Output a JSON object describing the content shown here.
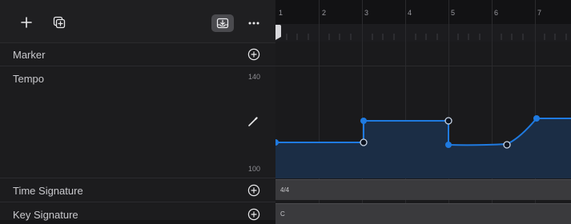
{
  "toolbar": {
    "add_icon": "plus-icon",
    "duplicate_icon": "duplicate-icon",
    "import_icon": "import-tray-icon",
    "more_icon": "ellipsis-icon"
  },
  "rows": {
    "marker": "Marker",
    "tempo": "Tempo",
    "tempo_max": "140",
    "tempo_min": "100",
    "time_signature": "Time Signature",
    "key_signature": "Key Signature"
  },
  "ruler": {
    "bars": [
      "1",
      "2",
      "3",
      "4",
      "5",
      "6",
      "7"
    ]
  },
  "tracks": {
    "time_signature_value": "4/4",
    "key_signature_value": "C"
  },
  "colors": {
    "accent": "#1f7ae0",
    "tempo_fill": "#1b2d45"
  }
}
